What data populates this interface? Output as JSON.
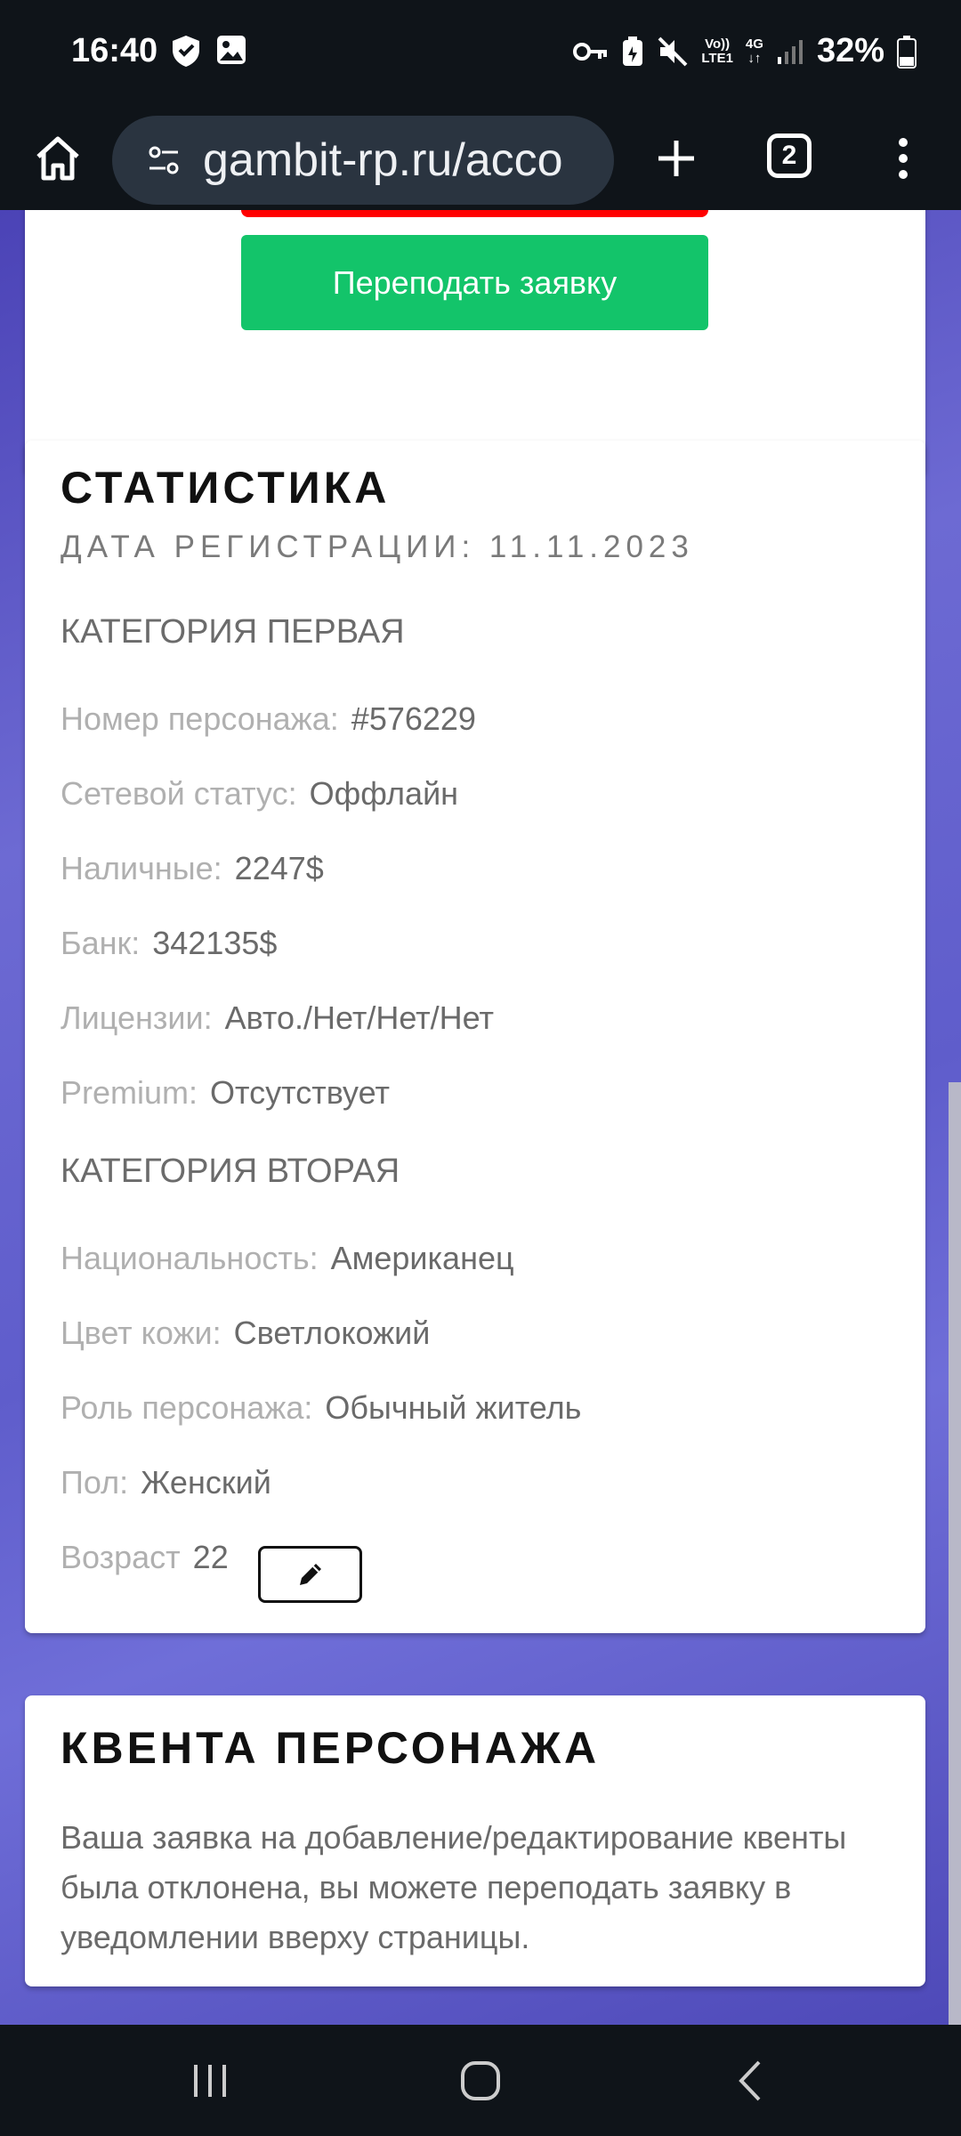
{
  "status_bar": {
    "time": "16:40",
    "icons_left": [
      "shield-icon",
      "image-icon"
    ],
    "icons_right": [
      "key-icon",
      "battery-saver-icon",
      "mute-icon",
      "volte-icon",
      "4g-icon",
      "signal-icon",
      "battery-icon"
    ],
    "volte_line1": "Vo))",
    "volte_line2": "LTE1",
    "net_type": "4G",
    "battery": "32%"
  },
  "browser": {
    "url": "gambit-rp.ru/acco",
    "tab_count": "2"
  },
  "top_card": {
    "resubmit_button": "Переподать заявку",
    "colors": {
      "danger": "#ff0000",
      "success": "#13c46a"
    }
  },
  "stats": {
    "title": "СТАТИСТИКА",
    "registration": "ДАТА РЕГИСТРАЦИИ: 11.11.2023",
    "category1": {
      "title": "КАТЕГОРИЯ ПЕРВАЯ",
      "rows": [
        {
          "label": "Номер персонажа:",
          "value": "#576229"
        },
        {
          "label": "Сетевой статус:",
          "value": "Оффлайн"
        },
        {
          "label": "Наличные:",
          "value": "2247$"
        },
        {
          "label": "Банк:",
          "value": "342135$"
        },
        {
          "label": "Лицензии:",
          "value": "Авто./Нет/Нет/Нет"
        },
        {
          "label": "Premium:",
          "value": "Отсутствует"
        }
      ]
    },
    "category2": {
      "title": "КАТЕГОРИЯ ВТОРАЯ",
      "rows": [
        {
          "label": "Национальность:",
          "value": "Американец"
        },
        {
          "label": "Цвет кожи:",
          "value": "Светлокожий"
        },
        {
          "label": "Роль персонажа:",
          "value": "Обычный житель"
        },
        {
          "label": "Пол:",
          "value": "Женский"
        }
      ]
    },
    "age": {
      "label": "Возраст",
      "value": "22"
    }
  },
  "quenta": {
    "title": "КВЕНТА ПЕРСОНАЖА",
    "text": "Ваша заявка на добавление/редактирование квенты была отклонена, вы можете переподать заявку в уведомлении вверху страницы."
  }
}
